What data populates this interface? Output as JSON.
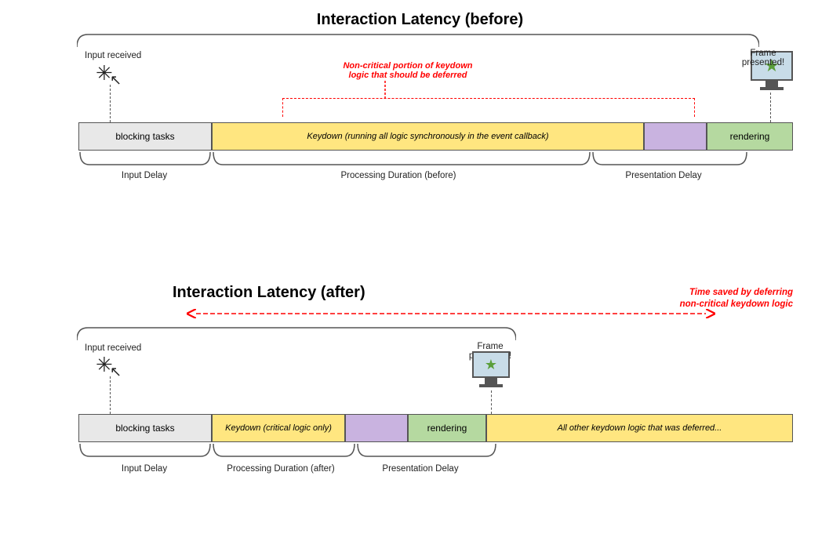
{
  "top": {
    "title": "Interaction Latency (before)",
    "input_received": "Input received",
    "frame_presented": "Frame presented!",
    "blocking_tasks": "blocking tasks",
    "keydown_label": "Keydown (running all logic synchronously in the event callback)",
    "rendering": "rendering",
    "input_delay": "Input Delay",
    "processing_duration": "Processing Duration (before)",
    "presentation_delay": "Presentation Delay",
    "red_label_line1": "Non-critical portion of keydown",
    "red_label_line2": "logic that should be deferred"
  },
  "bottom": {
    "title": "Interaction Latency (after)",
    "input_received": "Input received",
    "frame_presented": "Frame presented!",
    "blocking_tasks": "blocking tasks",
    "keydown_label": "Keydown (critical logic only)",
    "rendering": "rendering",
    "deferred_label": "All other keydown logic that was deferred...",
    "input_delay": "Input Delay",
    "processing_duration": "Processing Duration (after)",
    "presentation_delay": "Presentation Delay",
    "time_saved_line1": "Time saved by deferring",
    "time_saved_line2": "non-critical keydown logic"
  }
}
